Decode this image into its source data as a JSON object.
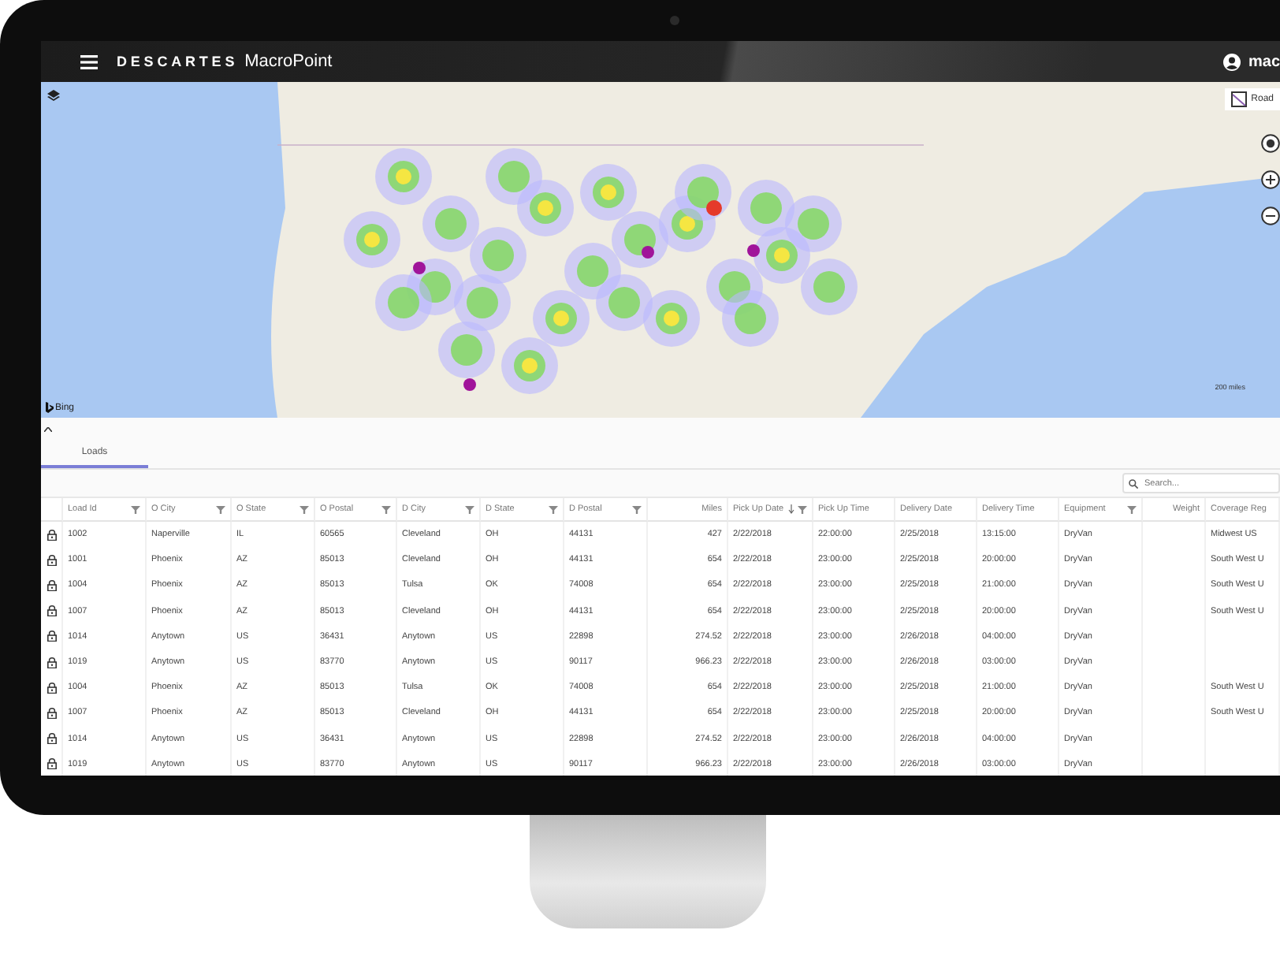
{
  "header": {
    "brand": "DESCARTES",
    "product": "MacroPoint",
    "user": "mac"
  },
  "map": {
    "map_type_button": "Road",
    "provider": "Bing",
    "scale": "200 miles"
  },
  "tabs": [
    {
      "label": "Loads",
      "selected": true
    }
  ],
  "search": {
    "placeholder": "Search..."
  },
  "table": {
    "columns": [
      {
        "label": "Load Id",
        "filter": true
      },
      {
        "label": "O City",
        "filter": true
      },
      {
        "label": "O State",
        "filter": true
      },
      {
        "label": "O Postal",
        "filter": true
      },
      {
        "label": "D City",
        "filter": true
      },
      {
        "label": "D State",
        "filter": true
      },
      {
        "label": "D Postal",
        "filter": true
      },
      {
        "label": "Miles",
        "filter": false,
        "numeric": true
      },
      {
        "label": "Pick Up Date",
        "filter": true,
        "sorted_descending": true
      },
      {
        "label": "Pick Up Time",
        "filter": false
      },
      {
        "label": "Delivery Date",
        "filter": false
      },
      {
        "label": "Delivery Time",
        "filter": false
      },
      {
        "label": "Equipment",
        "filter": true
      },
      {
        "label": "Weight",
        "filter": false,
        "numeric": true
      },
      {
        "label": "Coverage Reg",
        "filter": false
      }
    ],
    "rows": [
      {
        "cells": [
          "1002",
          "Naperville",
          "IL",
          "60565",
          "Cleveland",
          "OH",
          "44131",
          "427",
          "2/22/2018",
          "22:00:00",
          "2/25/2018",
          "13:15:00",
          "DryVan"
        ],
        "coverage": "Midwest US"
      },
      {
        "cells": [
          "1001",
          "Phoenix",
          "AZ",
          "85013",
          "Cleveland",
          "OH",
          "44131",
          "654",
          "2/22/2018",
          "23:00:00",
          "2/25/2018",
          "20:00:00",
          "DryVan"
        ],
        "coverage": "South West U"
      },
      {
        "cells": [
          "1004",
          "Phoenix",
          "AZ",
          "85013",
          "Tulsa",
          "OK",
          "74008",
          "654",
          "2/22/2018",
          "23:00:00",
          "2/25/2018",
          "21:00:00",
          "DryVan"
        ],
        "coverage": "South West U"
      },
      {
        "cells": [
          "1007",
          "Phoenix",
          "AZ",
          "85013",
          "Cleveland",
          "OH",
          "44131",
          "654",
          "2/22/2018",
          "23:00:00",
          "2/25/2018",
          "20:00:00",
          "DryVan"
        ],
        "coverage": "South West U"
      },
      {
        "cells": [
          "1014",
          "Anytown",
          "US",
          "36431",
          "Anytown",
          "US",
          "22898",
          "274.52",
          "2/22/2018",
          "23:00:00",
          "2/26/2018",
          "04:00:00",
          "DryVan"
        ]
      },
      {
        "cells": [
          "1019",
          "Anytown",
          "US",
          "83770",
          "Anytown",
          "US",
          "90117",
          "966.23",
          "2/22/2018",
          "23:00:00",
          "2/26/2018",
          "03:00:00",
          "DryVan"
        ]
      },
      {
        "cells": [
          "1004",
          "Phoenix",
          "AZ",
          "85013",
          "Tulsa",
          "OK",
          "74008",
          "654",
          "2/22/2018",
          "23:00:00",
          "2/25/2018",
          "21:00:00",
          "DryVan"
        ],
        "coverage": "South West U"
      },
      {
        "cells": [
          "1007",
          "Phoenix",
          "AZ",
          "85013",
          "Cleveland",
          "OH",
          "44131",
          "654",
          "2/22/2018",
          "23:00:00",
          "2/25/2018",
          "20:00:00",
          "DryVan"
        ],
        "coverage": "South West U"
      },
      {
        "cells": [
          "1014",
          "Anytown",
          "US",
          "36431",
          "Anytown",
          "US",
          "22898",
          "274.52",
          "2/22/2018",
          "23:00:00",
          "2/26/2018",
          "04:00:00",
          "DryVan"
        ]
      },
      {
        "cells": [
          "1019",
          "Anytown",
          "US",
          "83770",
          "Anytown",
          "US",
          "90117",
          "966.23",
          "2/22/2018",
          "23:00:00",
          "2/26/2018",
          "03:00:00",
          "DryVan"
        ]
      }
    ]
  }
}
